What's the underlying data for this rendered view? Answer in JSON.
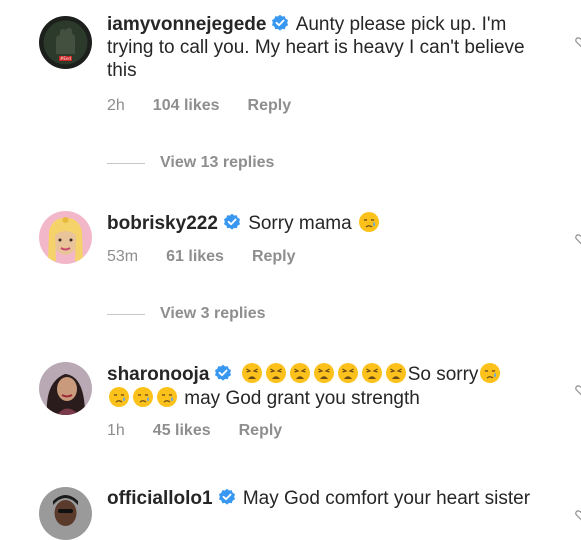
{
  "comments": [
    {
      "username": "iamyvonnejegede",
      "text": "Aunty please pick up. I'm trying to call you. My heart is heavy I can't believe this",
      "time": "2h",
      "likes": "104 likes",
      "reply_label": "Reply",
      "view_replies": "View 13 replies"
    },
    {
      "username": "bobrisky222",
      "text": "Sorry mama",
      "time": "53m",
      "likes": "61 likes",
      "reply_label": "Reply",
      "view_replies": "View 3 replies"
    },
    {
      "username": "sharonooja",
      "text_a": "So sorry",
      "text_b": "may God grant you strength",
      "time": "1h",
      "likes": "45 likes",
      "reply_label": "Reply"
    },
    {
      "username": "officiallolo1",
      "text": "May God comfort your heart sister"
    }
  ],
  "icons": {
    "verified": "verified-badge-icon",
    "crying": "crying-face-emoji",
    "weary": "weary-face-emoji",
    "like": "heart-outline-icon"
  },
  "colors": {
    "verified_blue": "#3897f0",
    "muted_text": "#8e8e8e",
    "primary_text": "#262626"
  }
}
